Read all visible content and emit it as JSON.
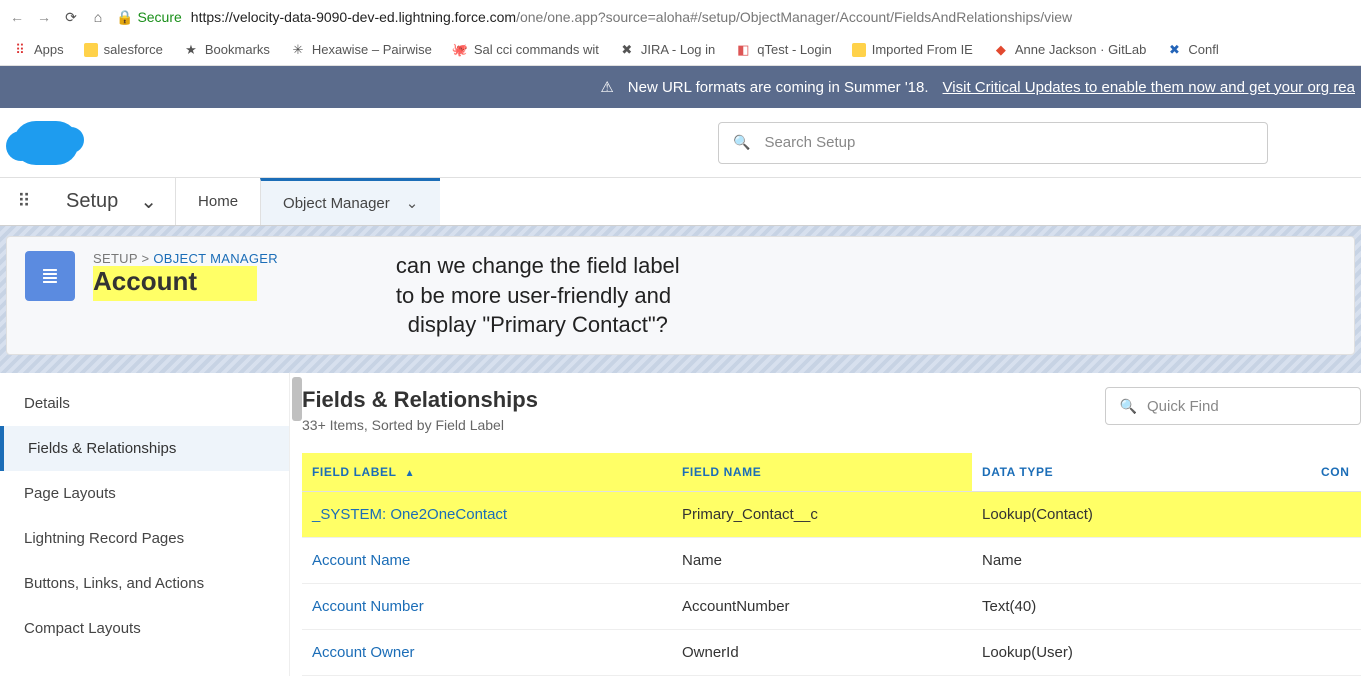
{
  "browser": {
    "secure_label": "Secure",
    "url_host": "https://velocity-data-9090-dev-ed.lightning.force.com",
    "url_path": "/one/one.app?source=aloha#/setup/ObjectManager/Account/FieldsAndRelationships/view"
  },
  "bookmarks": {
    "apps": "Apps",
    "items": [
      "salesforce",
      "Bookmarks",
      "Hexawise – Pairwise",
      "Sal cci commands wit",
      "JIRA - Log in",
      "qTest - Login",
      "Imported From IE",
      "Anne Jackson · GitLab",
      "Confl"
    ]
  },
  "banner": {
    "text": "New URL formats are coming in Summer '18.",
    "link": "Visit Critical Updates to enable them now and get your org rea"
  },
  "search": {
    "placeholder": "Search Setup"
  },
  "nav": {
    "setup": "Setup",
    "home": "Home",
    "object_manager": "Object Manager"
  },
  "object_header": {
    "crumb_setup": "SETUP",
    "crumb_sep": " > ",
    "crumb_link": "OBJECT MANAGER",
    "title": "Account",
    "annotation_l1": "can we change the field label",
    "annotation_l2": "to be more user-friendly and",
    "annotation_l3": "display \"Primary Contact\"?"
  },
  "rail": {
    "items": [
      "Details",
      "Fields & Relationships",
      "Page Layouts",
      "Lightning Record Pages",
      "Buttons, Links, and Actions",
      "Compact Layouts"
    ],
    "active_index": 1
  },
  "content": {
    "title": "Fields & Relationships",
    "subtitle": "33+ Items, Sorted by Field Label",
    "quickfind_placeholder": "Quick Find",
    "columns": {
      "label": "FIELD LABEL",
      "name": "FIELD NAME",
      "type": "DATA TYPE",
      "controlling": "CON"
    },
    "rows": [
      {
        "label": "_SYSTEM: One2OneContact",
        "name": "Primary_Contact__c",
        "type": "Lookup(Contact)",
        "highlight": true
      },
      {
        "label": "Account Name",
        "name": "Name",
        "type": "Name"
      },
      {
        "label": "Account Number",
        "name": "AccountNumber",
        "type": "Text(40)"
      },
      {
        "label": "Account Owner",
        "name": "OwnerId",
        "type": "Lookup(User)"
      }
    ]
  }
}
